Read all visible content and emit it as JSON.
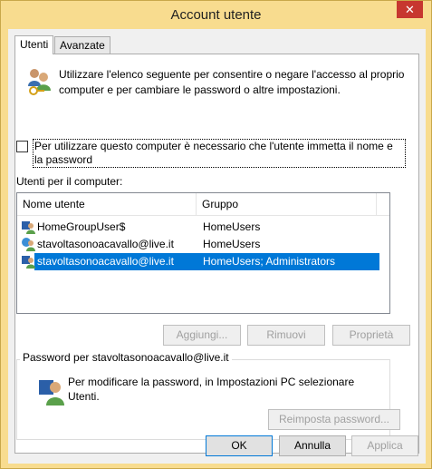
{
  "window": {
    "title": "Account utente",
    "close_glyph": "✕"
  },
  "tabs": [
    {
      "label": "Utenti",
      "active": true
    },
    {
      "label": "Avanzate",
      "active": false
    }
  ],
  "users_tab": {
    "description": "Utilizzare l'elenco seguente per consentire o negare l'accesso al proprio computer e per cambiare le password o altre impostazioni.",
    "require_login_checkbox": {
      "label": "Per utilizzare questo computer è necessario che l'utente immetta il nome e la password",
      "checked": false
    },
    "users_list_title": "Utenti per il computer:",
    "columns": [
      "Nome utente",
      "Gruppo"
    ],
    "users": [
      {
        "name": "HomeGroupUser$",
        "group": "HomeUsers",
        "icon": "user-group-icon",
        "selected": false
      },
      {
        "name": "stavoltasonoacavallo@live.it",
        "group": "HomeUsers",
        "icon": "microsoft-account-user-icon",
        "selected": false
      },
      {
        "name": "stavoltasonoacavallo@live.it",
        "group": "HomeUsers; Administrators",
        "icon": "admin-user-icon",
        "selected": true
      }
    ],
    "buttons": {
      "add": "Aggiungi...",
      "remove": "Rimuovi",
      "properties": "Proprietà"
    },
    "password_group": {
      "title": "Password per stavoltasonoacavallo@live.it",
      "text": "Per modificare la password, in Impostazioni PC selezionare Utenti.",
      "reset_button": "Reimposta password..."
    }
  },
  "dialog_buttons": {
    "ok": "OK",
    "cancel": "Annulla",
    "apply": "Applica"
  },
  "colors": {
    "frame": "#f8dc8f",
    "close": "#c7372f",
    "selection": "#0078d7"
  }
}
